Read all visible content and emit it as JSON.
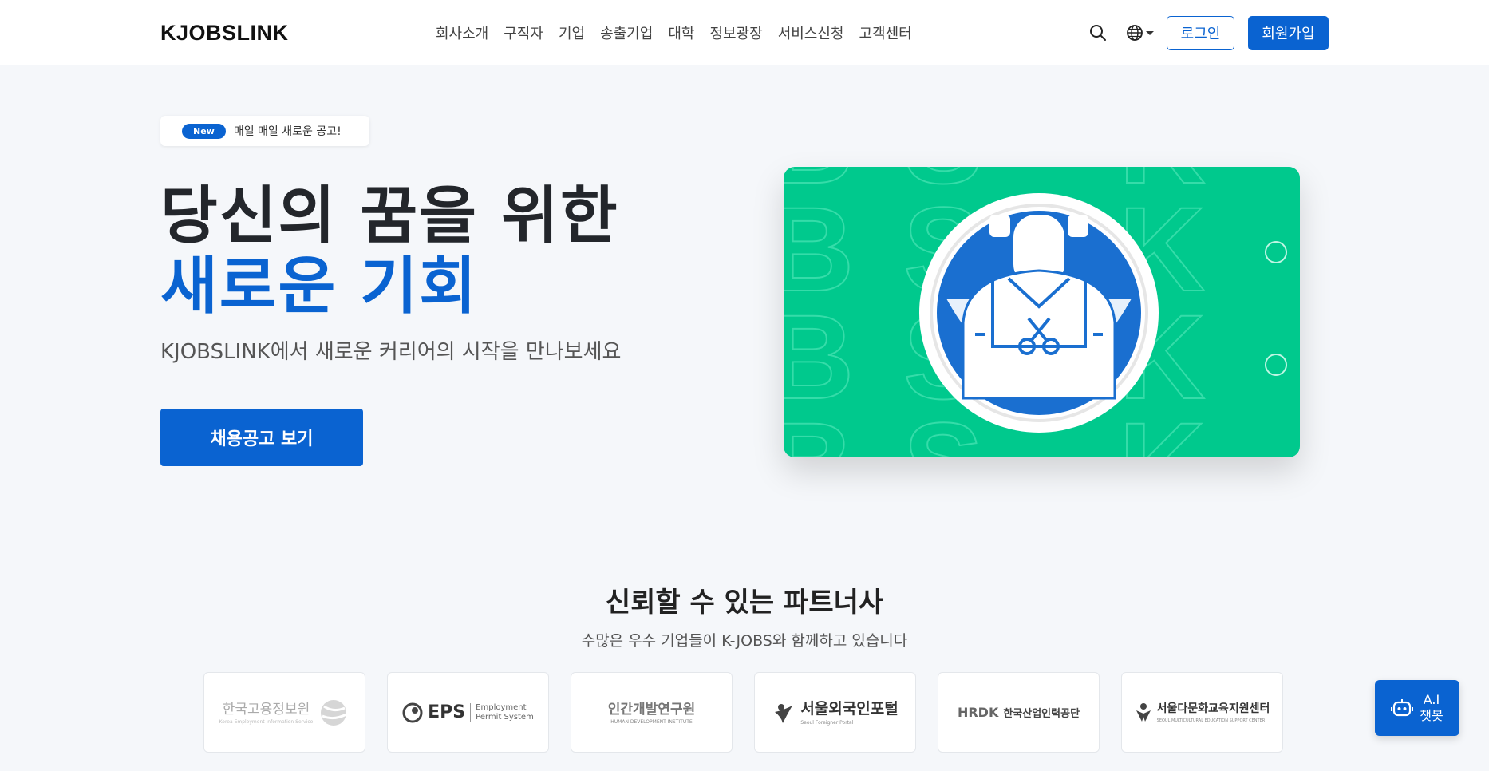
{
  "brand": {
    "name": "KJOBSLINK"
  },
  "nav": {
    "items": [
      "회사소개",
      "구직자",
      "기업",
      "송출기업",
      "대학",
      "정보광장",
      "서비스신청",
      "고객센터"
    ],
    "login_label": "로그인",
    "signup_label": "회원가입",
    "search_icon": "search-icon",
    "language_icon": "globe-icon"
  },
  "hero": {
    "badge_label": "New",
    "badge_text": "매일 매일 새로운 공고!",
    "title_line1": "당신의 꿈을 위한",
    "title_line2": "새로운 기회",
    "subtitle": "KJOBSLINK에서 새로운 커리어의 시작을 만나보세요",
    "cta_label": "채용공고 보기",
    "image_description_icon": "worker-illustration"
  },
  "partners": {
    "title": "신뢰할 수 있는 파트너사",
    "subtitle": "수많은 우수 기업들이 K-JOBS와 함께하고 있습니다",
    "logos": [
      {
        "name": "한국고용정보원",
        "sub": "Korea Employment Information Service"
      },
      {
        "name": "EPS",
        "sub1": "Employment",
        "sub2": "Permit System"
      },
      {
        "name": "인간개발연구원",
        "sub": "HUMAN DEVELOPMENT INSTITUTE"
      },
      {
        "name": "서울외국인포털",
        "sub": "Seoul Foreigner Portal"
      },
      {
        "name": "한국산업인력공단",
        "prefix": "HRDK"
      },
      {
        "name": "서울다문화교육지원센터",
        "sub": "SEOUL MULTICULTURAL EDUCATION SUPPORT CENTER"
      }
    ]
  },
  "chatbot": {
    "line1": "A.I",
    "line2": "챗봇"
  },
  "colors": {
    "primary": "#0a63d1",
    "hero_image_bg": "#00c98d",
    "text_dark": "#23262b"
  }
}
